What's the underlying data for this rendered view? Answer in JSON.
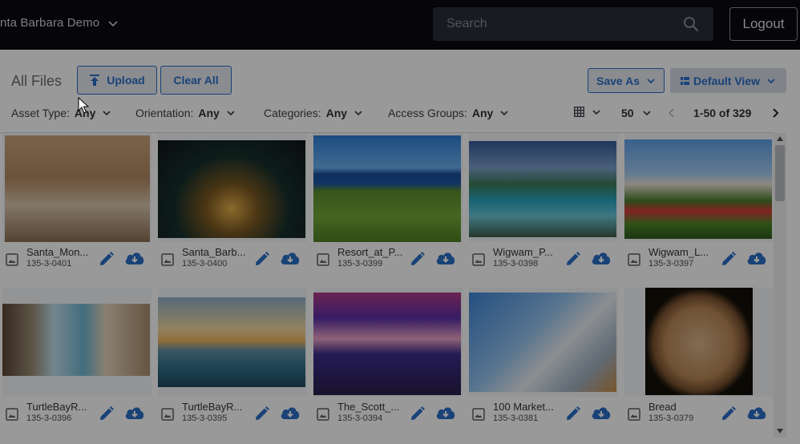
{
  "header": {
    "workspace_name": "nta Barbara Demo",
    "search_placeholder": "Search",
    "logout_label": "Logout"
  },
  "toolbar": {
    "title": "All Files",
    "upload_label": "Upload",
    "clear_all_label": "Clear All",
    "save_as_label": "Save As",
    "default_view_label": "Default View"
  },
  "filters": [
    {
      "label": "Asset Type:",
      "value": "Any"
    },
    {
      "label": "Orientation:",
      "value": "Any"
    },
    {
      "label": "Categories:",
      "value": "Any"
    },
    {
      "label": "Access Groups:",
      "value": "Any"
    }
  ],
  "pagination": {
    "per_page": "50",
    "range": "1-50 of 329"
  },
  "assets": [
    {
      "name": "Santa_Mon...",
      "id": "135-3-0401",
      "scene": "bedroom"
    },
    {
      "name": "Santa_Barb...",
      "id": "135-3-0400",
      "scene": "night"
    },
    {
      "name": "Resort_at_P...",
      "id": "135-3-0399",
      "scene": "golf"
    },
    {
      "name": "Wigwam_P...",
      "id": "135-3-0398",
      "scene": "pool"
    },
    {
      "name": "Wigwam_L...",
      "id": "135-3-0397",
      "scene": "garden"
    },
    {
      "name": "TurtleBayR...",
      "id": "135-3-0396",
      "scene": "ocean-room"
    },
    {
      "name": "TurtleBayR...",
      "id": "135-3-0395",
      "scene": "sunset"
    },
    {
      "name": "The_Scott_...",
      "id": "135-3-0394",
      "scene": "hall"
    },
    {
      "name": "100 Market...",
      "id": "135-3-0381",
      "scene": "building"
    },
    {
      "name": "Bread",
      "id": "135-3-0379",
      "scene": "bread"
    }
  ],
  "colors": {
    "accent": "#2a6fc7",
    "topbar": "#0a0b12"
  }
}
